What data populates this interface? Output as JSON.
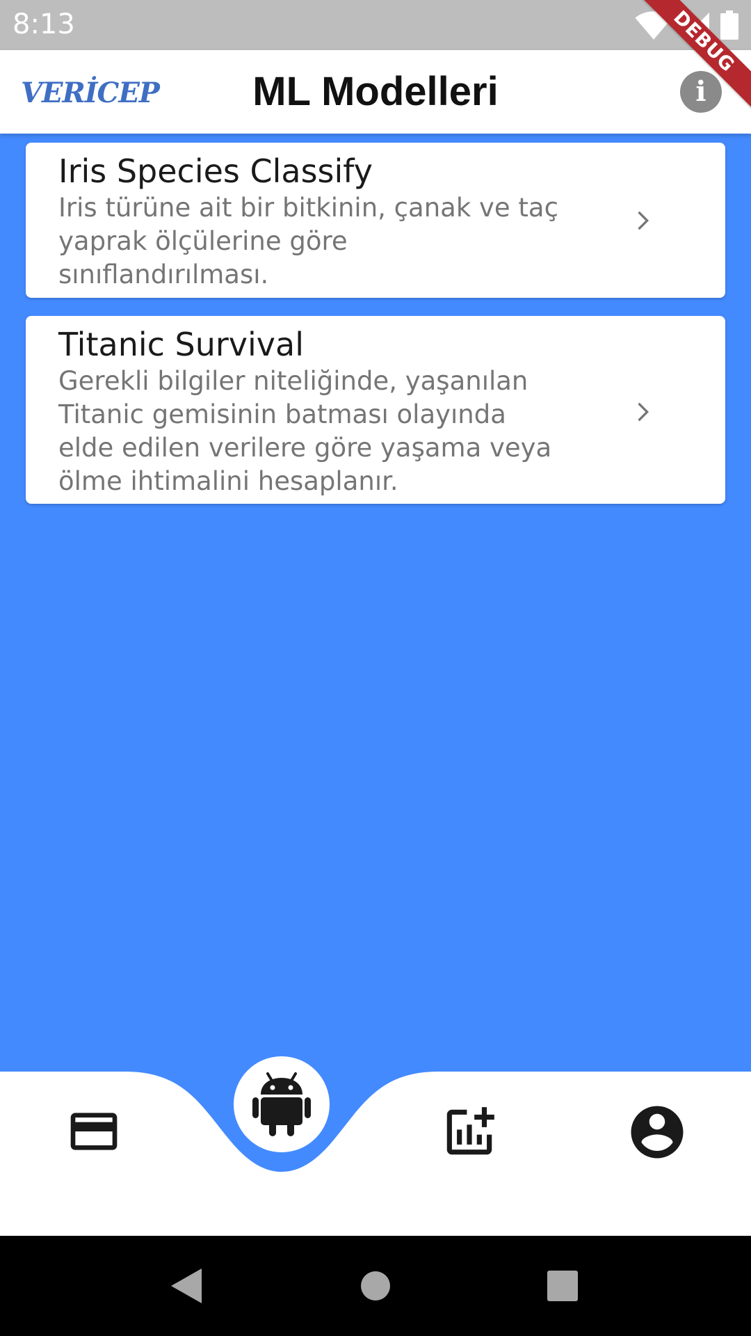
{
  "status_bar": {
    "time": "8:13",
    "icons": [
      "wifi-icon",
      "signal-icon",
      "battery-icon"
    ]
  },
  "debug_banner": "DEBUG",
  "app_bar": {
    "logo_text": "VERİCEP",
    "title": "ML Modelleri",
    "info_icon": "info-icon"
  },
  "models": [
    {
      "title": "Iris Species Classify",
      "description": "Iris türüne ait bir bitkinin, çanak ve taç yaprak ölçülerine göre sınıflandırılması."
    },
    {
      "title": "Titanic Survival",
      "description": "Gerekli bilgiler niteliğinde, yaşanılan Titanic gemisinin batması olayında elde edilen verilere göre yaşama veya ölme ihtimalini hesaplanır."
    }
  ],
  "bottom_nav": {
    "items": [
      "credit-card-icon",
      "android-icon",
      "add-chart-icon",
      "account-circle-icon"
    ],
    "selected": "android-icon"
  },
  "colors": {
    "background": "#448AFF",
    "app_bar": "#FFFFFF",
    "logo": "#3F6FC4",
    "debug_ribbon": "#B5282E",
    "status_bar": "#BDBDBD"
  }
}
